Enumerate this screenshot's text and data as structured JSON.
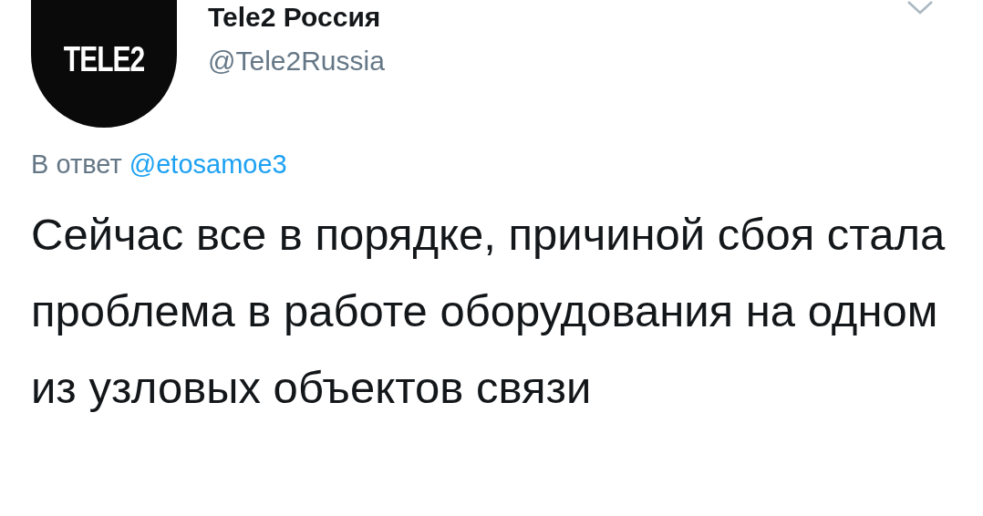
{
  "author": {
    "logo": "TELE2",
    "name": "Tele2 Россия",
    "handle": "@Tele2Russia"
  },
  "reply": {
    "prefix": "В ответ",
    "mention": "@etosamoe3"
  },
  "text": "Сейчас все в порядке, причиной сбоя стала проблема в работе оборудования на одном из узловых объектов связи"
}
